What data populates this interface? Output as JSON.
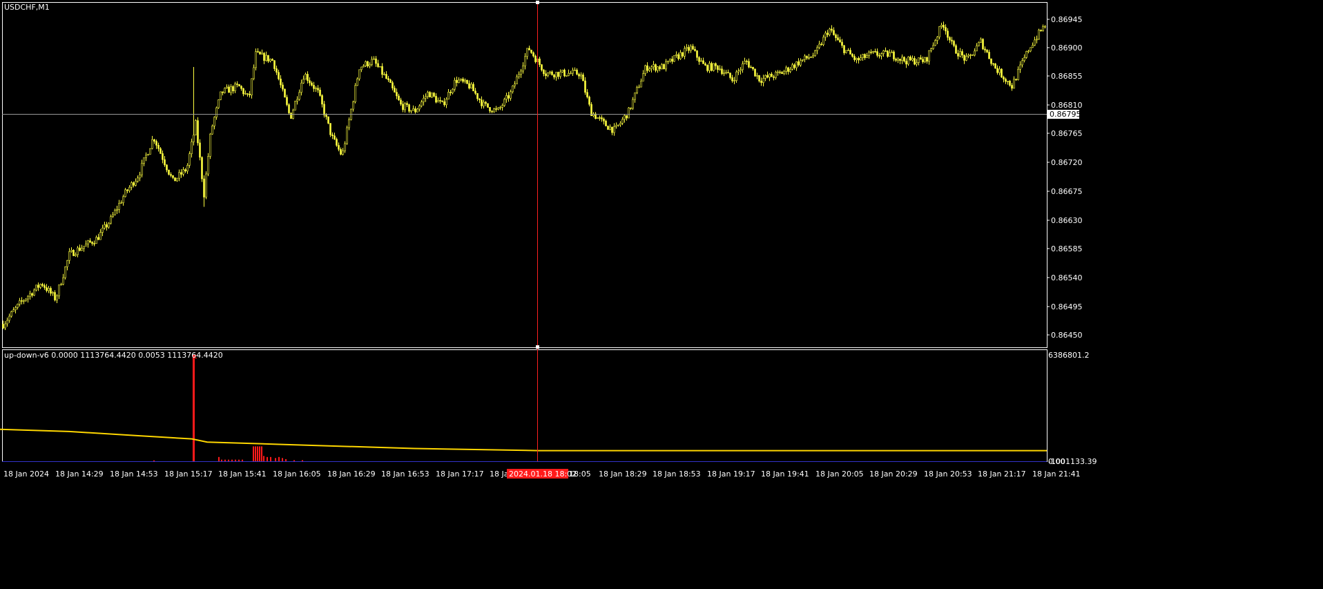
{
  "window": {
    "symbol_label": "USDCHF,M1"
  },
  "price_axis": {
    "ticks": [
      "0.86945",
      "0.86900",
      "0.86855",
      "0.86810",
      "0.86765",
      "0.86720",
      "0.86675",
      "0.86630",
      "0.86585",
      "0.86540",
      "0.86495",
      "0.86450"
    ],
    "current_price_label": "0.86795"
  },
  "time_axis": {
    "labels": [
      "18 Jan 2024",
      "18 Jan 14:29",
      "18 Jan 14:53",
      "18 Jan 15:17",
      "18 Jan 15:41",
      "18 Jan 16:05",
      "18 Jan 16:29",
      "18 Jan 16:53",
      "18 Jan 17:17",
      "18 Ja",
      "18:05",
      "18 Jan 18:29",
      "18 Jan 18:53",
      "18 Jan 19:17",
      "18 Jan 19:41",
      "18 Jan 20:05",
      "18 Jan 20:29",
      "18 Jan 20:53",
      "18 Jan 21:17",
      "18 Jan 21:41"
    ],
    "crosshair_label": "2024.01.18 18:02"
  },
  "indicator": {
    "label": "up-down-v6 0.0000 1113764.4420 0.0053 1113764.4420",
    "axis_top": "6386801.2",
    "axis_bottom": "-1001133.39",
    "axis_zero": "0.00"
  },
  "colors": {
    "background": "#000000",
    "candles": "#ffff40",
    "grid_text": "#ffffff",
    "crosshair": "#ff2020",
    "indicator_line": "#ffd700",
    "indicator_histogram": "#ff1a1a",
    "baseline": "#3333cc"
  },
  "chart_data": {
    "type": "line",
    "title": "USDCHF,M1",
    "ylim": [
      0.8643,
      0.8697
    ],
    "anchors": [
      [
        0,
        0.8646
      ],
      [
        30,
        0.865
      ],
      [
        60,
        0.8653
      ],
      [
        80,
        0.86505
      ],
      [
        100,
        0.86575
      ],
      [
        140,
        0.866
      ],
      [
        160,
        0.8663
      ],
      [
        180,
        0.8667
      ],
      [
        200,
        0.867
      ],
      [
        222,
        0.8676
      ],
      [
        230,
        0.8674
      ],
      [
        250,
        0.8669
      ],
      [
        270,
        0.8671
      ],
      [
        283,
        0.8678
      ],
      [
        295,
        0.8667
      ],
      [
        305,
        0.8677
      ],
      [
        320,
        0.8683
      ],
      [
        345,
        0.8684
      ],
      [
        360,
        0.8682
      ],
      [
        370,
        0.8689
      ],
      [
        395,
        0.8688
      ],
      [
        420,
        0.8679
      ],
      [
        440,
        0.8686
      ],
      [
        460,
        0.8683
      ],
      [
        480,
        0.8676
      ],
      [
        495,
        0.8673
      ],
      [
        520,
        0.8687
      ],
      [
        540,
        0.8688
      ],
      [
        560,
        0.8685
      ],
      [
        580,
        0.8681
      ],
      [
        600,
        0.868
      ],
      [
        620,
        0.8683
      ],
      [
        640,
        0.8681
      ],
      [
        660,
        0.8685
      ],
      [
        680,
        0.8684
      ],
      [
        700,
        0.8681
      ],
      [
        720,
        0.868
      ],
      [
        740,
        0.8683
      ],
      [
        765,
        0.869
      ],
      [
        790,
        0.8686
      ],
      [
        840,
        0.8686
      ],
      [
        855,
        0.868
      ],
      [
        875,
        0.8678
      ],
      [
        890,
        0.8677
      ],
      [
        910,
        0.868
      ],
      [
        935,
        0.8687
      ],
      [
        960,
        0.8687
      ],
      [
        985,
        0.8689
      ],
      [
        1000,
        0.869
      ],
      [
        1020,
        0.8687
      ],
      [
        1040,
        0.8687
      ],
      [
        1060,
        0.8685
      ],
      [
        1080,
        0.8688
      ],
      [
        1100,
        0.8685
      ],
      [
        1130,
        0.8686
      ],
      [
        1160,
        0.8688
      ],
      [
        1180,
        0.8689
      ],
      [
        1200,
        0.8693
      ],
      [
        1220,
        0.869
      ],
      [
        1240,
        0.8688
      ],
      [
        1260,
        0.8689
      ],
      [
        1290,
        0.8689
      ],
      [
        1310,
        0.8688
      ],
      [
        1340,
        0.8688
      ],
      [
        1365,
        0.8694
      ],
      [
        1380,
        0.869
      ],
      [
        1400,
        0.8688
      ],
      [
        1420,
        0.8691
      ],
      [
        1440,
        0.8687
      ],
      [
        1465,
        0.8684
      ],
      [
        1490,
        0.869
      ],
      [
        1515,
        0.8694
      ]
    ],
    "indicator_line": [
      [
        0,
        0.3
      ],
      [
        100,
        0.28
      ],
      [
        200,
        0.24
      ],
      [
        278,
        0.21
      ],
      [
        300,
        0.18
      ],
      [
        400,
        0.16
      ],
      [
        500,
        0.14
      ],
      [
        600,
        0.12
      ],
      [
        780,
        0.1
      ],
      [
        1100,
        0.1
      ],
      [
        1516,
        0.1
      ]
    ],
    "indicator_spike": 1.0,
    "indicator_bars": [
      [
        222,
        0.008
      ],
      [
        316,
        0.04
      ],
      [
        320,
        0.015
      ],
      [
        325,
        0.015
      ],
      [
        330,
        0.015
      ],
      [
        335,
        0.015
      ],
      [
        340,
        0.015
      ],
      [
        345,
        0.015
      ],
      [
        350,
        0.015
      ],
      [
        366,
        0.14
      ],
      [
        369,
        0.14
      ],
      [
        372,
        0.14
      ],
      [
        375,
        0.14
      ],
      [
        378,
        0.14
      ],
      [
        381,
        0.05
      ],
      [
        386,
        0.04
      ],
      [
        391,
        0.04
      ],
      [
        398,
        0.03
      ],
      [
        403,
        0.04
      ],
      [
        408,
        0.03
      ],
      [
        413,
        0.02
      ],
      [
        425,
        0.01
      ],
      [
        437,
        0.01
      ]
    ]
  }
}
